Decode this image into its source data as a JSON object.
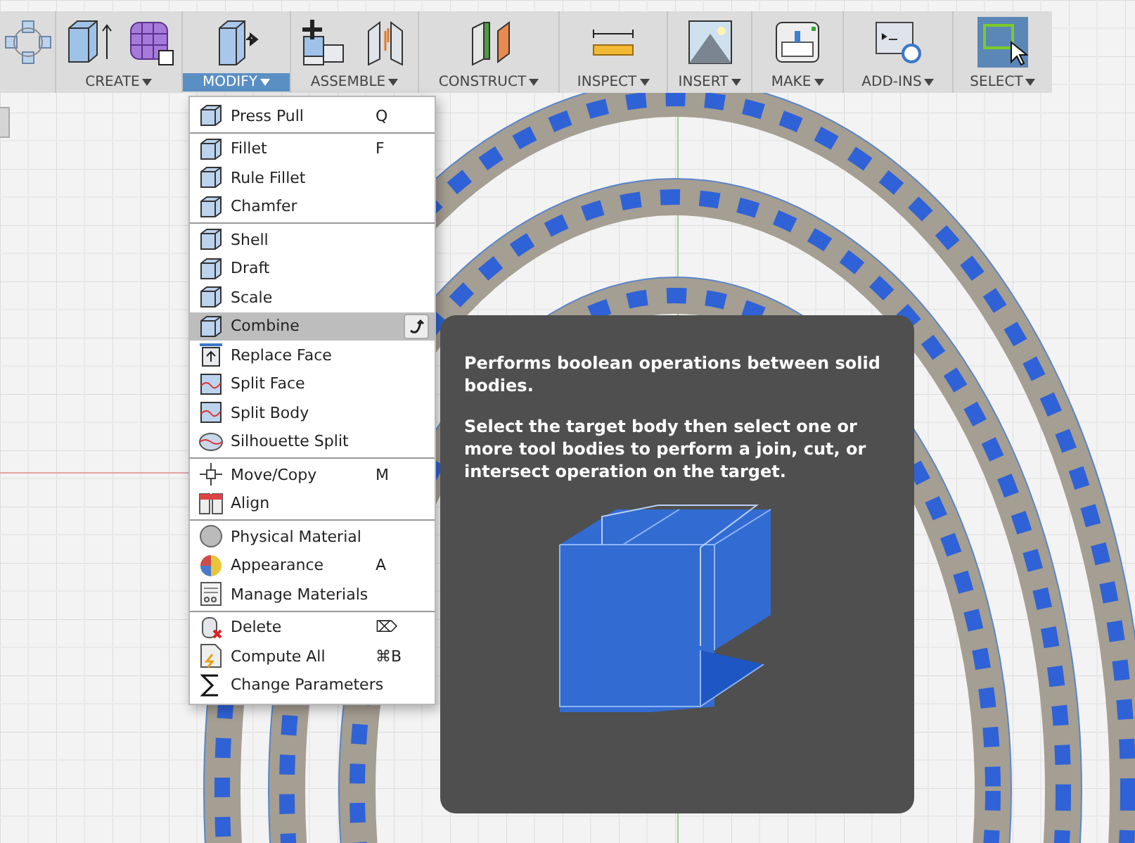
{
  "toolbar": {
    "groups": [
      {
        "icons": [
          {
            "kind": "nodes",
            "selected": false
          }
        ]
      },
      {
        "label": "CREATE",
        "selected": false,
        "icons": [
          {
            "kind": "box",
            "selected": false
          },
          {
            "kind": "form",
            "selected": false
          }
        ]
      },
      {
        "label": "MODIFY",
        "selected": true,
        "icons": [
          {
            "kind": "presspull",
            "selected": false
          }
        ]
      },
      {
        "label": "ASSEMBLE",
        "selected": false,
        "icons": [
          {
            "kind": "joint",
            "selected": false
          },
          {
            "kind": "asbuilt",
            "selected": false
          }
        ]
      },
      {
        "label": "CONSTRUCT",
        "selected": false,
        "icons": [
          {
            "kind": "planes",
            "selected": false
          }
        ]
      },
      {
        "label": "INSPECT",
        "selected": false,
        "icons": [
          {
            "kind": "ruler",
            "selected": false
          }
        ]
      },
      {
        "label": "INSERT",
        "selected": false,
        "icons": [
          {
            "kind": "image",
            "selected": false
          }
        ]
      },
      {
        "label": "MAKE",
        "selected": false,
        "icons": [
          {
            "kind": "printer",
            "selected": false
          }
        ]
      },
      {
        "label": "ADD-INS",
        "selected": false,
        "icons": [
          {
            "kind": "script",
            "selected": false
          }
        ]
      },
      {
        "label": "SELECT",
        "selected": false,
        "icons": [
          {
            "kind": "select",
            "selected": true
          }
        ]
      }
    ]
  },
  "menu": {
    "items": [
      {
        "label": "Press Pull",
        "shortcut": "Q",
        "kind": "presspull",
        "separator_after": true,
        "selected": false
      },
      {
        "label": "Fillet",
        "shortcut": "F",
        "kind": "fillet",
        "separator_after": false,
        "selected": false
      },
      {
        "label": "Rule Fillet",
        "kind": "fillet",
        "separator_after": false,
        "selected": false
      },
      {
        "label": "Chamfer",
        "kind": "chamfer",
        "separator_after": true,
        "selected": false
      },
      {
        "label": "Shell",
        "kind": "shell",
        "separator_after": false,
        "selected": false
      },
      {
        "label": "Draft",
        "kind": "draft",
        "separator_after": false,
        "selected": false
      },
      {
        "label": "Scale",
        "kind": "scale",
        "separator_after": false,
        "selected": false
      },
      {
        "label": "Combine",
        "kind": "combine",
        "separator_after": false,
        "selected": true
      },
      {
        "label": "Replace Face",
        "kind": "replace",
        "separator_after": false,
        "selected": false
      },
      {
        "label": "Split Face",
        "kind": "splitface",
        "separator_after": false,
        "selected": false
      },
      {
        "label": "Split Body",
        "kind": "splitbody",
        "separator_after": false,
        "selected": false
      },
      {
        "label": "Silhouette Split",
        "kind": "silhouette",
        "separator_after": true,
        "selected": false
      },
      {
        "label": "Move/Copy",
        "shortcut": "M",
        "kind": "move",
        "separator_after": false,
        "selected": false
      },
      {
        "label": "Align",
        "kind": "align",
        "separator_after": true,
        "selected": false
      },
      {
        "label": "Physical Material",
        "kind": "material",
        "separator_after": false,
        "selected": false
      },
      {
        "label": "Appearance",
        "shortcut": "A",
        "kind": "appearance",
        "separator_after": false,
        "selected": false
      },
      {
        "label": "Manage Materials",
        "kind": "manage",
        "separator_after": true,
        "selected": false
      },
      {
        "label": "Delete",
        "shortcut": "⌦",
        "kind": "delete",
        "separator_after": false,
        "selected": false
      },
      {
        "label": "Compute All",
        "shortcut": "⌘B",
        "kind": "compute",
        "separator_after": false,
        "selected": false
      },
      {
        "label": "Change Parameters",
        "kind": "sigma",
        "separator_after": false,
        "selected": false
      }
    ]
  },
  "tooltip": {
    "paragraphs": [
      "Performs boolean operations between solid bodies.",
      "Select the target body then select one or more tool bodies to perform a join, cut, or intersect operation on the target."
    ]
  }
}
